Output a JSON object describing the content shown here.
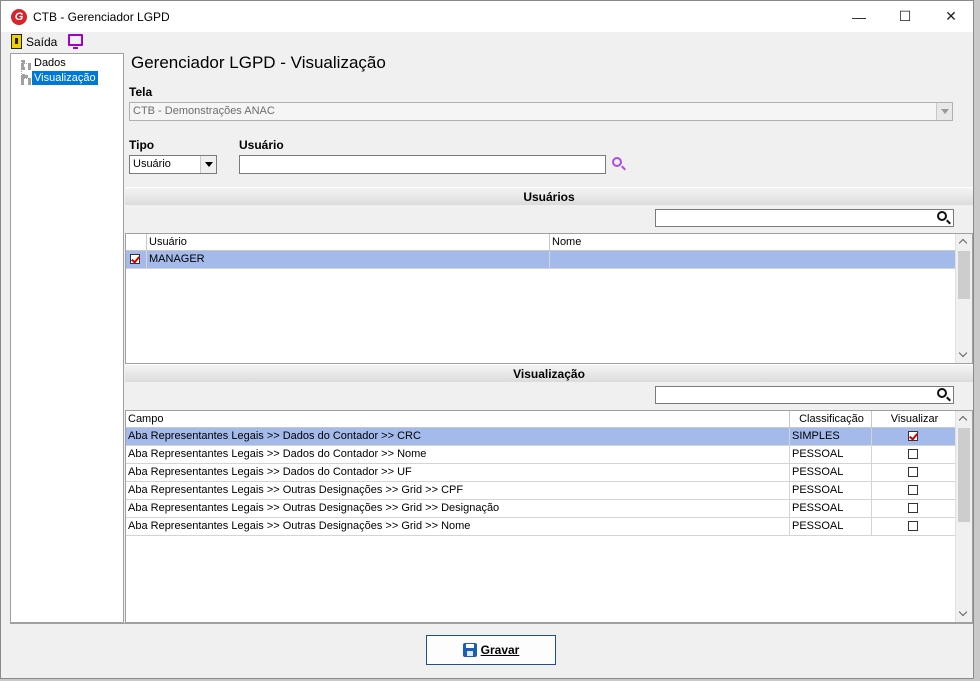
{
  "window": {
    "title": "CTB - Gerenciador LGPD",
    "logo_letter": "G",
    "controls": {
      "minimize": "—",
      "maximize": "☐",
      "close": "✕"
    }
  },
  "toolbar": {
    "exit_label": "Saída"
  },
  "tree": {
    "items": [
      {
        "label": "Dados",
        "selected": false
      },
      {
        "label": "Visualização",
        "selected": true
      }
    ]
  },
  "page": {
    "title": "Gerenciador LGPD - Visualização"
  },
  "form": {
    "tela_label": "Tela",
    "tela_value": "CTB - Demonstrações ANAC",
    "tipo_label": "Tipo",
    "tipo_value": "Usuário",
    "usuario_label": "Usuário",
    "usuario_value": ""
  },
  "usuarios": {
    "header": "Usuários",
    "search_value": "",
    "columns": [
      "Usuário",
      "Nome"
    ],
    "rows": [
      {
        "checked": true,
        "usuario": "MANAGER",
        "nome": ""
      }
    ]
  },
  "visualizacao": {
    "header": "Visualização",
    "search_value": "",
    "columns": [
      "Campo",
      "Classificação",
      "Visualizar"
    ],
    "rows": [
      {
        "campo": "Aba Representantes Legais  >>  Dados do Contador  >>  CRC",
        "classificacao": "SIMPLES",
        "visualizar": true
      },
      {
        "campo": "Aba Representantes Legais  >>  Dados do Contador  >>  Nome",
        "classificacao": "PESSOAL",
        "visualizar": false
      },
      {
        "campo": "Aba Representantes Legais  >>  Dados do Contador  >>  UF",
        "classificacao": "PESSOAL",
        "visualizar": false
      },
      {
        "campo": "Aba Representantes Legais  >>  Outras Designações >> Grid >> CPF",
        "classificacao": "PESSOAL",
        "visualizar": false
      },
      {
        "campo": "Aba Representantes Legais  >>  Outras Designações >> Grid >> Designação",
        "classificacao": "PESSOAL",
        "visualizar": false
      },
      {
        "campo": "Aba Representantes Legais  >>  Outras Designações >> Grid >> Nome",
        "classificacao": "PESSOAL",
        "visualizar": false
      }
    ]
  },
  "actions": {
    "save_label": "Gravar"
  },
  "colors": {
    "selection": "#a3baea",
    "tree_selection": "#0078d7",
    "check_mark": "#d40000"
  }
}
